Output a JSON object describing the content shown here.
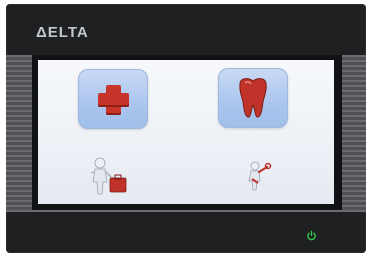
{
  "brand": {
    "logo_text": "ΔELTA",
    "logo_icon": "delta-triangle-icon"
  },
  "screen": {
    "buttons": [
      {
        "name": "medical-cross-button",
        "icon": "red-cross-icon"
      },
      {
        "name": "tooth-button",
        "icon": "tooth-icon"
      }
    ],
    "figures": [
      {
        "name": "worker-with-toolbox-figure",
        "icon": "figure-toolbox-icon"
      },
      {
        "name": "worker-with-wrench-figure",
        "icon": "figure-wrench-icon"
      }
    ]
  },
  "indicators": {
    "power": "power-icon",
    "power_color": "#31c24a"
  },
  "colors": {
    "accent_red": "#c7342a",
    "tile_blue": "#aac5ee",
    "bezel": "#1f2022"
  }
}
